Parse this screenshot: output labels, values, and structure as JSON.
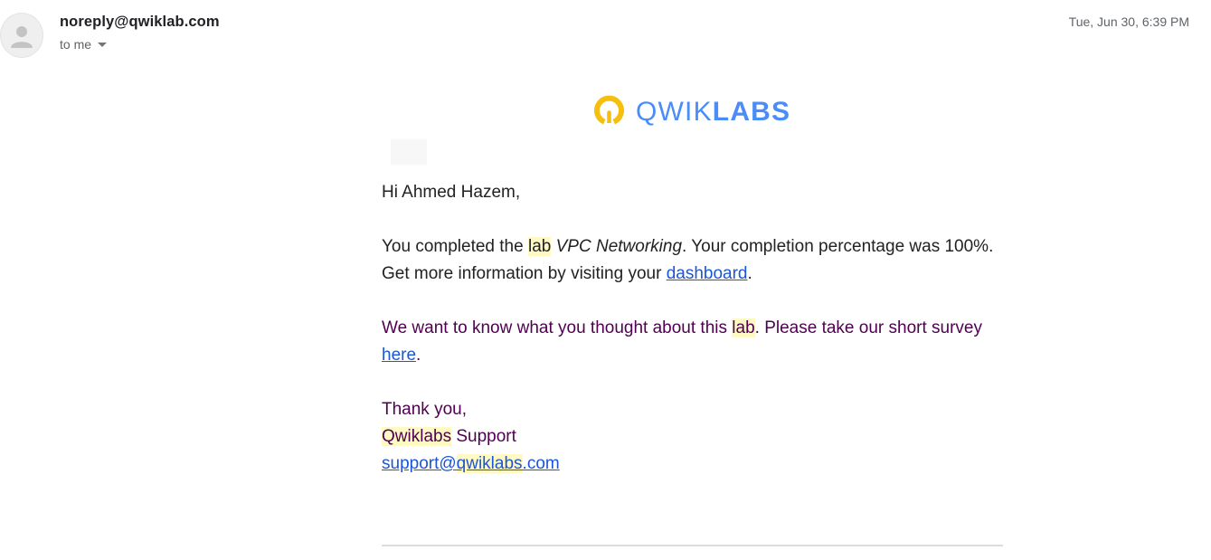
{
  "header": {
    "sender": "noreply@qwiklab.com",
    "recipient": "to me",
    "timestamp": "Tue, Jun 30, 6:39 PM"
  },
  "logo": {
    "text_light": "QWIK",
    "text_bold": "LABS",
    "colors": {
      "ring": "#f5bf10",
      "text": "#4a8df8"
    }
  },
  "message": {
    "greeting": "Hi Ahmed Hazem,",
    "p1": {
      "before": "You completed the ",
      "lab_word": "lab",
      "space": " ",
      "lab_name": "VPC Networking",
      "after": ". Your completion percentage was 100%. Get more information by visiting your ",
      "link": "dashboard",
      "end": "."
    },
    "p2": {
      "before": "We want to know what you thought about this ",
      "lab_word": "lab",
      "after": ". Please take our short survey ",
      "link": "here",
      "end": "."
    },
    "closing": {
      "thanks": "Thank you,",
      "brand": "Qwiklabs",
      "support_suffix": " Support",
      "email_prefix": "support@",
      "email_brand": "qwiklabs",
      "email_suffix": ".com"
    }
  },
  "colors": {
    "highlight": "#fff9c4",
    "link": "#1a56d6",
    "quoted_text": "#500050"
  }
}
